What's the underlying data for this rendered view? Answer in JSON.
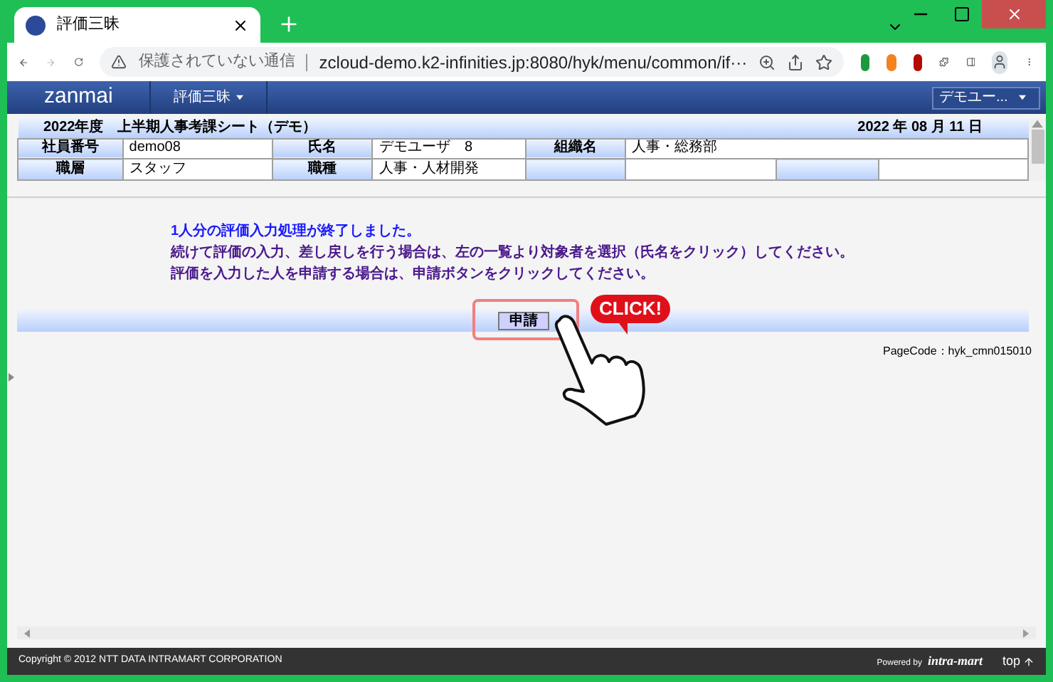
{
  "browser": {
    "tab_title": "評価三昧",
    "url_warning": "保護されていない通信",
    "url": "zcloud-demo.k2-infinities.jp:8080/hyk/menu/common/if···"
  },
  "app": {
    "logo": "zanmai",
    "menu": "評価三昧",
    "user_menu": "デモユー..."
  },
  "sheet": {
    "title": "2022年度　上半期人事考課シート（デモ）",
    "date": "2022 年 08 月 11 日",
    "rows": [
      [
        {
          "label": "社員番号",
          "value": "demo08"
        },
        {
          "label": "氏名",
          "value": "デモユーザ　8"
        },
        {
          "label": "組織名",
          "value": "人事・総務部"
        }
      ],
      [
        {
          "label": "職層",
          "value": "スタッフ"
        },
        {
          "label": "職種",
          "value": "人事・人材開発"
        }
      ]
    ]
  },
  "messages": [
    {
      "kind": "status",
      "text": "1人分の評価入力処理が終了しました。"
    },
    {
      "kind": "instruction",
      "text": "続けて評価の入力、差し戻しを行う場合は、左の一覧より対象者を選択（氏名をクリック）してください。"
    },
    {
      "kind": "instruction",
      "text": "評価を入力した人を申請する場合は、申請ボタンをクリックしてください。"
    }
  ],
  "submit_button": {
    "label": "申請",
    "highlighted": true
  },
  "callout": "CLICK!",
  "page_code": "PageCode：hyk_cmn015010",
  "footer": {
    "copyright": "Copyright © 2012 NTT DATA INTRAMART CORPORATION",
    "powered_by": "Powered by",
    "brand": "intra-mart",
    "top_link": "top"
  }
}
